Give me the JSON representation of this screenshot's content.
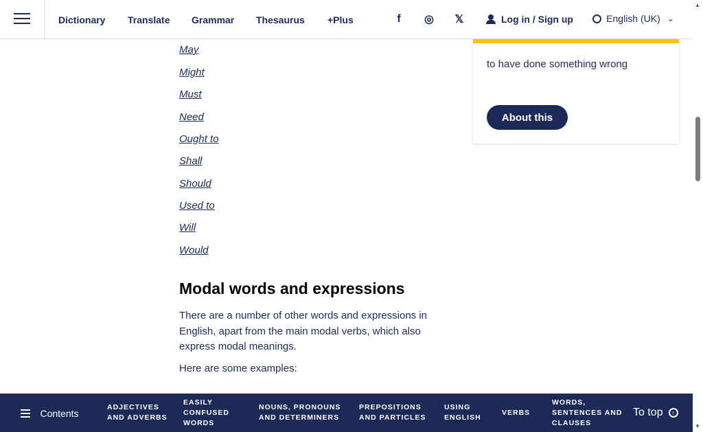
{
  "header": {
    "nav": [
      {
        "label": "Dictionary"
      },
      {
        "label": "Translate"
      },
      {
        "label": "Grammar"
      },
      {
        "label": "Thesaurus"
      },
      {
        "label": "+Plus"
      }
    ],
    "social": [
      {
        "icon": "facebook-icon",
        "glyph": "f"
      },
      {
        "icon": "instagram-icon",
        "glyph": "◎"
      },
      {
        "icon": "x-twitter-icon",
        "glyph": "𝕏"
      }
    ],
    "login_label": "Log in / Sign up",
    "language_label": "English (UK)"
  },
  "article": {
    "modals": [
      "May",
      "Might",
      "Must",
      "Need",
      "Ought to",
      "Shall",
      "Should",
      "Used to",
      "Will",
      "Would"
    ],
    "section_title": "Modal words and expressions",
    "intro": "There are a number of other  words and expressions in English, apart from the main modal verbs, which also express modal meanings.",
    "examples_lead": "Here are some examples:"
  },
  "card": {
    "definition": "to have done something wrong",
    "about_label": "About this",
    "accent_color": "#fec400"
  },
  "bottom_nav": {
    "contents_label": "Contents",
    "items": [
      {
        "label": "ADJECTIVES AND ADVERBS"
      },
      {
        "label": "EASILY CONFUSED WORDS"
      },
      {
        "label": "NOUNS, PRONOUNS AND DETERMINERS"
      },
      {
        "label": "PREPOSITIONS AND PARTICLES"
      },
      {
        "label": "USING ENGLISH"
      },
      {
        "label": "VERBS"
      },
      {
        "label": "WORDS, SENTENCES AND CLAUSES"
      }
    ],
    "to_top_label": "To top"
  },
  "colors": {
    "brand": "#1d2a57",
    "accent": "#fec400"
  }
}
